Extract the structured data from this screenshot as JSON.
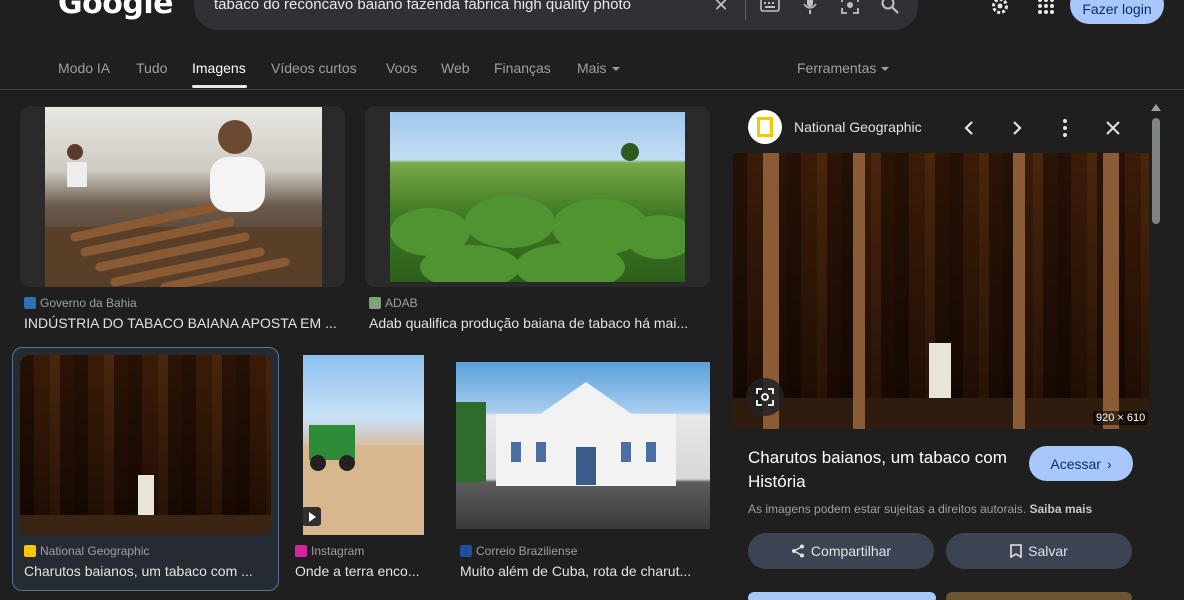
{
  "header": {
    "logo": "Google",
    "search_value": "tabaco do recôncavo baiano fazenda fábrica high quality photo",
    "login_label": "Fazer login"
  },
  "tabs": [
    {
      "label": "Modo IA"
    },
    {
      "label": "Tudo"
    },
    {
      "label": "Imagens"
    },
    {
      "label": "Vídeos curtos"
    },
    {
      "label": "Voos"
    },
    {
      "label": "Web"
    },
    {
      "label": "Finanças"
    },
    {
      "label": "Mais"
    }
  ],
  "tools_label": "Ferramentas",
  "results": [
    {
      "source": "Governo da Bahia",
      "title": "INDÚSTRIA DO TABACO BAIANA APOSTA EM ..."
    },
    {
      "source": "ADAB",
      "title": "Adab qualifica produção baiana de tabaco há mai..."
    },
    {
      "source": "National Geographic",
      "title": "Charutos baianos, um tabaco com ..."
    },
    {
      "source": "Instagram",
      "title": "Onde a terra enco..."
    },
    {
      "source": "Correio Braziliense",
      "title": "Muito além de Cuba, rota de charut..."
    }
  ],
  "panel": {
    "source": "National Geographic",
    "dimensions": "920 × 610",
    "title": "Charutos baianos, um tabaco com História",
    "visit_label": "Acessar",
    "copyright_text": "As imagens podem estar sujeitas a direitos autorais.",
    "learn_more": "Saiba mais",
    "share_label": "Compartilhar",
    "save_label": "Salvar"
  },
  "colors": {
    "background": "#1f1f1f",
    "accent": "#a8c7fa",
    "selection_border": "#8ab4f8"
  }
}
